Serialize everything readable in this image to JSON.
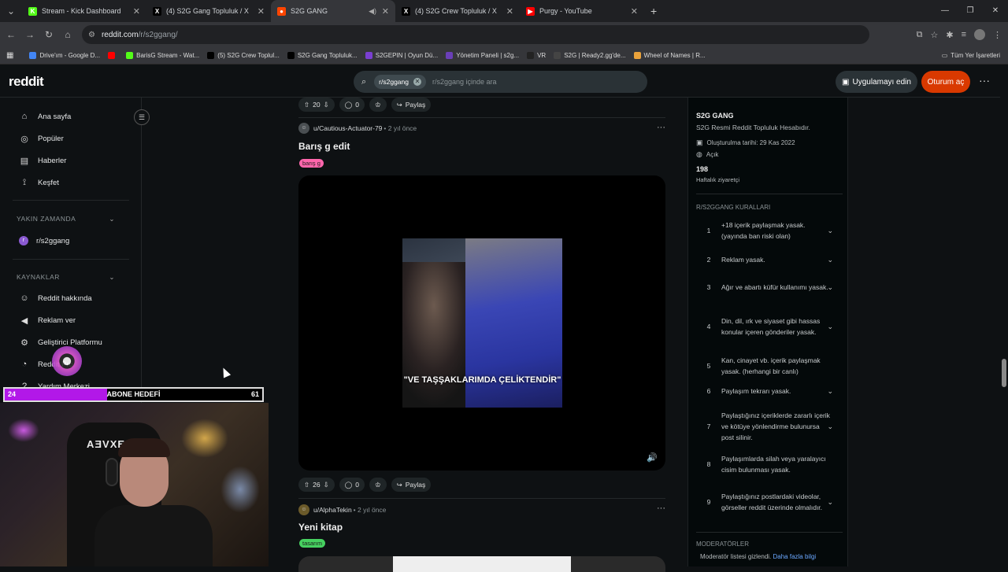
{
  "browser": {
    "tabs": [
      {
        "label": "Stream - Kick Dashboard",
        "icon": "kick-icon",
        "color": "#53fc18",
        "glyph": "K"
      },
      {
        "label": "(4) S2G Gang Topluluk / X",
        "icon": "x-icon",
        "color": "#000000",
        "glyph": "X"
      },
      {
        "label": "S2G GANG",
        "icon": "reddit-icon",
        "color": "#ff4500",
        "glyph": "●",
        "active": true
      },
      {
        "label": "(4) S2G Crew Topluluk / X",
        "icon": "x-icon",
        "color": "#000000",
        "glyph": "X"
      },
      {
        "label": "Purgy - YouTube",
        "icon": "youtube-icon",
        "color": "#ff0000",
        "glyph": "▶"
      }
    ],
    "url_host": "reddit.com",
    "url_path": "/r/s2ggang/",
    "bookmarks": [
      {
        "label": "Drive'ım - Google D...",
        "icon": "drive-icon"
      },
      {
        "label": "",
        "icon": "youtube-icon"
      },
      {
        "label": "BarisG Stream - Wat...",
        "icon": "kick-icon"
      },
      {
        "label": "(5) S2G Crew Toplul...",
        "icon": "x-icon"
      },
      {
        "label": "S2G Gang Topluluk...",
        "icon": "x-icon"
      },
      {
        "label": "S2GEPIN | Oyun Dü...",
        "icon": "s2gepin-icon"
      },
      {
        "label": "Yönetim Paneli | s2g...",
        "icon": "panel-icon"
      },
      {
        "label": "VR",
        "icon": "vr-icon"
      },
      {
        "label": "S2G | Ready2.gg'de...",
        "icon": "ready2-icon"
      },
      {
        "label": "Wheel of Names | R...",
        "icon": "wheel-icon"
      }
    ],
    "all_bookmarks": "Tüm Yer İşaretleri"
  },
  "header": {
    "logo": "reddit",
    "search_chip": "r/s2ggang",
    "search_placeholder": "r/s2ggang içinde ara",
    "get_app": "Uygulamayı edin",
    "login": "Oturum aç"
  },
  "sidebar": {
    "items": [
      {
        "label": "Ana sayfa",
        "icon": "home-icon"
      },
      {
        "label": "Popüler",
        "icon": "popular-icon"
      },
      {
        "label": "Haberler",
        "icon": "news-icon"
      },
      {
        "label": "Keşfet",
        "icon": "explore-icon"
      }
    ],
    "recent_header": "YAKIN ZAMANDA",
    "recent": [
      {
        "label": "r/s2ggang",
        "icon": "subreddit-icon"
      }
    ],
    "resources_header": "KAYNAKLAR",
    "resources": [
      {
        "label": "Reddit hakkında",
        "icon": "reddit-about-icon"
      },
      {
        "label": "Reklam ver",
        "icon": "megaphone-icon"
      },
      {
        "label": "Geliştirici Platformu",
        "icon": "dev-icon"
      },
      {
        "label": "Reddit Pro",
        "icon": "pro-icon"
      },
      {
        "label": "Yardım Merkezi",
        "icon": "help-icon"
      }
    ]
  },
  "feed": {
    "top_actions": {
      "votes": "20",
      "comments": "0",
      "share": "Paylaş"
    },
    "posts": [
      {
        "author": "u/Cautious-Actuator-79",
        "time": "2 yıl önce",
        "title": "Barış g edit",
        "flair": "barış g",
        "flair_color": "#ff66ac",
        "video_caption": "\"VE TAŞŞAKLARIMDA ÇELİKTENDİR\"",
        "votes": "26",
        "comments": "0",
        "share": "Paylaş"
      },
      {
        "author": "u/AlphaTekin",
        "time": "2 yıl önce",
        "title": "Yeni kitap",
        "flair": "tasarım",
        "flair_color": "#46d160"
      }
    ]
  },
  "community": {
    "name": "S2G GANG",
    "description": "S2G Resmi Reddit Topluluk Hesabıdır.",
    "created": "Oluşturulma tarihi: 29 Kas 2022",
    "visibility": "Açık",
    "weekly_visitors": "198",
    "weekly_label": "Haftalık ziyaretçi",
    "rules_header": "R/S2GGANG KURALLARI",
    "rules": [
      {
        "num": "1",
        "text": "+18 içerik paylaşmak yasak. (yayında ban riski olan)",
        "expand": true
      },
      {
        "num": "2",
        "text": "Reklam yasak.",
        "expand": true
      },
      {
        "num": "3",
        "text": "Ağır ve abartı küfür kullanımı yasak.",
        "expand": true
      },
      {
        "num": "4",
        "text": "Din, dil, ırk ve siyaset gibi hassas konular içeren gönderiler yasak.",
        "expand": true
      },
      {
        "num": "5",
        "text": "Kan, cinayet vb. içerik paylaşmak yasak. (herhangi bir canlı)",
        "expand": false
      },
      {
        "num": "6",
        "text": "Paylaşım tekrarı yasak.",
        "expand": true
      },
      {
        "num": "7",
        "text": "Paylaştığınız içeriklerde zararlı içerik ve kötüye yönlendirme bulunursa post silinir.",
        "expand": true
      },
      {
        "num": "8",
        "text": "Paylaşımlarda silah veya yaralayıcı cisim bulunması yasak.",
        "expand": false
      },
      {
        "num": "9",
        "text": "Paylaştığınız postlardaki videolar, görseller reddit üzerinde olmalıdır.",
        "expand": true
      }
    ],
    "moderators_header": "MODERATÖRLER",
    "moderators_hidden": "Moderatör listesi gizlendi.",
    "more_info": "Daha fazla bilgi"
  },
  "stream_overlay": {
    "goal_current": "24",
    "goal_label": "ABONE HEDEFİ",
    "goal_target": "61",
    "goal_fill_color": "#b218e8",
    "chair_text": "AƎVXE"
  }
}
